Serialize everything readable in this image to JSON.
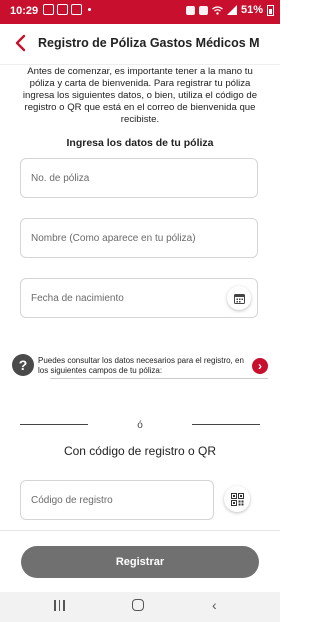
{
  "status_bar": {
    "time": "10:29",
    "battery": "51%",
    "left_icons": [
      "photo-icon",
      "notification-icon",
      "messaging-icon"
    ],
    "right_icons": [
      "alarm-icon",
      "mute-icon",
      "wifi-icon",
      "signal-icon",
      "battery-icon"
    ]
  },
  "header": {
    "title": "Registro de Póliza Gastos Médicos M"
  },
  "intro_text": "Antes de comenzar, es importante tener a la mano tu póliza y carta de bienvenida. Para registrar tu póliza ingresa los siguientes datos, o bien, utiliza el código de registro o QR que está en el correo de bienvenida que recibiste.",
  "form": {
    "section_title": "Ingresa los datos de tu póliza",
    "policy_number_placeholder": "No. de póliza",
    "name_placeholder": "Nombre (Como aparece en tu póliza)",
    "birthdate_placeholder": "Fecha de nacimiento"
  },
  "help": {
    "text": "Puedes consultar los datos necesarios para el registro, en los siguientes campos de tu póliza:"
  },
  "or_label": "ó",
  "qr_section": {
    "title": "Con código de registro o QR",
    "code_placeholder": "Código de registro"
  },
  "register_button": "Registrar",
  "colors": {
    "brand": "#c8102e",
    "button_disabled": "#707070"
  }
}
